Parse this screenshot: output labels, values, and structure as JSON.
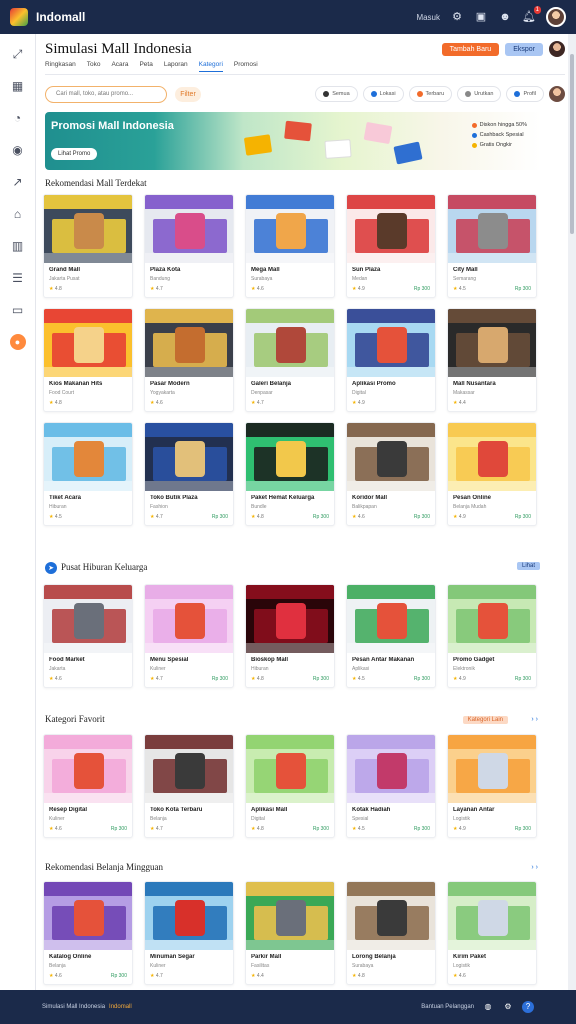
{
  "app": {
    "brand": "Indomall",
    "top_link": "Masuk",
    "notification_count": "1"
  },
  "sidebar": {
    "items": [
      {
        "icon": "collapse-icon"
      },
      {
        "icon": "dashboard-icon"
      },
      {
        "icon": "analytics-icon"
      },
      {
        "icon": "location-icon"
      },
      {
        "icon": "trend-icon"
      },
      {
        "icon": "store-icon"
      },
      {
        "icon": "layout-icon"
      },
      {
        "icon": "list-icon"
      },
      {
        "icon": "folder-icon"
      },
      {
        "icon": "promo-icon"
      }
    ]
  },
  "header": {
    "title": "Simulasi Mall Indonesia",
    "primary_button": "Tambah Baru",
    "secondary_button": "Ekspor"
  },
  "tabs": [
    "Ringkasan",
    "Toko",
    "Acara",
    "Peta",
    "Laporan",
    "Kategori",
    "Promosi"
  ],
  "tabs_active_index": 5,
  "search": {
    "placeholder": "Cari mall, toko, atau promo...",
    "chip": "Filter"
  },
  "filters": [
    {
      "label": "Semua",
      "dot": "#333333"
    },
    {
      "label": "Lokasi",
      "dot": "#1e6fd9"
    },
    {
      "label": "Terbaru",
      "dot": "#f26b2a"
    },
    {
      "label": "Urutkan",
      "dot": "#888888"
    },
    {
      "label": "Profil",
      "dot": "#1e6fd9"
    }
  ],
  "banner": {
    "title": "Promosi Mall Indonesia",
    "cta": "Lihat Promo",
    "list": [
      {
        "label": "Diskon hingga 50%",
        "dot": "#f26b2a"
      },
      {
        "label": "Cashback Spesial",
        "dot": "#1e6fd9"
      },
      {
        "label": "Gratis Ongkir",
        "dot": "#f5b301"
      }
    ]
  },
  "sections": [
    {
      "title": "Rekomendasi Mall Terdekat",
      "cards": [
        {
          "title": "Grand Mall",
          "sub": "Jakarta Pusat",
          "rating": "4.8",
          "price": "",
          "c1": "#f6d23b",
          "c2": "#3d4a5c",
          "c3": "#c98a4a"
        },
        {
          "title": "Plaza Kota",
          "sub": "Bandung",
          "rating": "4.7",
          "price": "",
          "c1": "#7b52c9",
          "c2": "#e6e9f0",
          "c3": "#d94d8a"
        },
        {
          "title": "Mega Mall",
          "sub": "Surabaya",
          "rating": "4.6",
          "price": "",
          "c1": "#2f6fd1",
          "c2": "#f0f2f6",
          "c3": "#f0a64a"
        },
        {
          "title": "Sun Plaza",
          "sub": "Medan",
          "rating": "4.9",
          "price": "Rp 300",
          "c1": "#d93434",
          "c2": "#fbe9e9",
          "c3": "#5a3a2a"
        },
        {
          "title": "City Mall",
          "sub": "Semarang",
          "rating": "4.5",
          "price": "Rp 300",
          "c1": "#c83c52",
          "c2": "#b9d7ef",
          "c3": "#8c8c8c"
        },
        {
          "title": "Kios Makanan Hits",
          "sub": "Food Court",
          "rating": "4.8",
          "price": "",
          "c1": "#e53935",
          "c2": "#fbc02d",
          "c3": "#f5d28a"
        },
        {
          "title": "Pasar Modern",
          "sub": "Yogyakarta",
          "rating": "4.6",
          "price": "",
          "c1": "#f2c14e",
          "c2": "#3a3f4a",
          "c3": "#c46d2f"
        },
        {
          "title": "Galeri Belanja",
          "sub": "Denpasar",
          "rating": "4.7",
          "price": "",
          "c1": "#9bc56b",
          "c2": "#e8eef3",
          "c3": "#b0483a"
        },
        {
          "title": "Aplikasi Promo",
          "sub": "Digital",
          "rating": "4.9",
          "price": "",
          "c1": "#2e3f8f",
          "c2": "#a8d9f2",
          "c3": "#e5523a"
        },
        {
          "title": "Mall Nusantara",
          "sub": "Makassar",
          "rating": "4.4",
          "price": "",
          "c1": "#6b4f3a",
          "c2": "#2a2a2a",
          "c3": "#d7a86e"
        },
        {
          "title": "Tiket Acara",
          "sub": "Hiburan",
          "rating": "4.5",
          "price": "",
          "c1": "#5fb7e4",
          "c2": "#d7eef9",
          "c3": "#e3873a"
        },
        {
          "title": "Toko Butik Plaza",
          "sub": "Fashion",
          "rating": "4.7",
          "price": "Rp 300",
          "c1": "#2a54a8",
          "c2": "#223050",
          "c3": "#e2c07a"
        },
        {
          "title": "Paket Hemat Keluarga",
          "sub": "Bundle",
          "rating": "4.8",
          "price": "Rp 300",
          "c1": "#1a1a1a",
          "c2": "#2fbf71",
          "c3": "#f2c84b"
        },
        {
          "title": "Koridor Mall",
          "sub": "Balikpapan",
          "rating": "4.6",
          "price": "Rp 300",
          "c1": "#7a5a3f",
          "c2": "#e9e3da",
          "c3": "#3a3a3a"
        },
        {
          "title": "Pesan Online",
          "sub": "Belanja Mudah",
          "rating": "4.9",
          "price": "Rp 300",
          "c1": "#f7c74a",
          "c2": "#fbe58b",
          "c3": "#e0483a"
        }
      ]
    },
    {
      "title": "Pusat Hiburan Keluarga",
      "action": "Lihat",
      "cards": [
        {
          "title": "Food Market",
          "sub": "Jakarta",
          "rating": "4.6",
          "price": "",
          "c1": "#b23a3a",
          "c2": "#eceef3",
          "c3": "#6a6f7a"
        },
        {
          "title": "Menu Spesial",
          "sub": "Kuliner",
          "rating": "4.7",
          "price": "Rp 300",
          "c1": "#e7a9e6",
          "c2": "#f5d0f3",
          "c3": "#e5523a"
        },
        {
          "title": "Bioskop Mall",
          "sub": "Hiburan",
          "rating": "4.8",
          "price": "Rp 300",
          "c1": "#8f0f1f",
          "c2": "#2a0509",
          "c3": "#e0303f"
        },
        {
          "title": "Pesan Antar Makanan",
          "sub": "Aplikasi",
          "rating": "4.5",
          "price": "Rp 300",
          "c1": "#3aa856",
          "c2": "#eef2f4",
          "c3": "#e5523a"
        },
        {
          "title": "Promo Gadget",
          "sub": "Elektronik",
          "rating": "4.9",
          "price": "Rp 300",
          "c1": "#7cc472",
          "c2": "#c7e9b4",
          "c3": "#e5523a"
        }
      ]
    },
    {
      "title": "Kategori Favorit",
      "action": "Kategori Lain",
      "cards": [
        {
          "title": "Resep Digital",
          "sub": "Kuliner",
          "rating": "4.6",
          "price": "Rp 300",
          "c1": "#f2a6d8",
          "c2": "#f8d3ea",
          "c3": "#e5523a"
        },
        {
          "title": "Toko Kota Terbaru",
          "sub": "Belanja",
          "rating": "4.7",
          "price": "",
          "c1": "#6e2a2a",
          "c2": "#e6e6e6",
          "c3": "#3a3a3a"
        },
        {
          "title": "Aplikasi Mall",
          "sub": "Digital",
          "rating": "4.8",
          "price": "Rp 300",
          "c1": "#8dd16b",
          "c2": "#c8ecb0",
          "c3": "#e5523a"
        },
        {
          "title": "Kotak Hadiah",
          "sub": "Spesial",
          "rating": "4.5",
          "price": "Rp 300",
          "c1": "#b7a1e8",
          "c2": "#dccff6",
          "c3": "#c23a6a"
        },
        {
          "title": "Layanan Antar",
          "sub": "Logistik",
          "rating": "4.9",
          "price": "Rp 300",
          "c1": "#f6a03a",
          "c2": "#fbd08c",
          "c3": "#cfd8e6"
        }
      ]
    },
    {
      "title": "Rekomendasi Belanja Mingguan",
      "cards": [
        {
          "title": "Katalog Online",
          "sub": "Belanja",
          "rating": "4.6",
          "price": "Rp 300",
          "c1": "#6b3fb0",
          "c2": "#b59de4",
          "c3": "#e5523a"
        },
        {
          "title": "Minuman Segar",
          "sub": "Kuliner",
          "rating": "4.7",
          "price": "",
          "c1": "#1e6fb5",
          "c2": "#9ed2ef",
          "c3": "#d8302a"
        },
        {
          "title": "Parkir Mall",
          "sub": "Fasilitas",
          "rating": "4.4",
          "price": "",
          "c1": "#f2c14e",
          "c2": "#3aa856",
          "c3": "#6a6f7a"
        },
        {
          "title": "Lorong Belanja",
          "sub": "Surabaya",
          "rating": "4.8",
          "price": "",
          "c1": "#8a6a4a",
          "c2": "#e9e3da",
          "c3": "#3a3a3a"
        },
        {
          "title": "Kirim Paket",
          "sub": "Logistik",
          "rating": "4.6",
          "price": "",
          "c1": "#7cc472",
          "c2": "#d6eec8",
          "c3": "#cfd8e6"
        }
      ]
    }
  ],
  "footer": {
    "text": "Simulasi Mall Indonesia",
    "accent": "Indomall",
    "link": "Bantuan Pelanggan"
  }
}
